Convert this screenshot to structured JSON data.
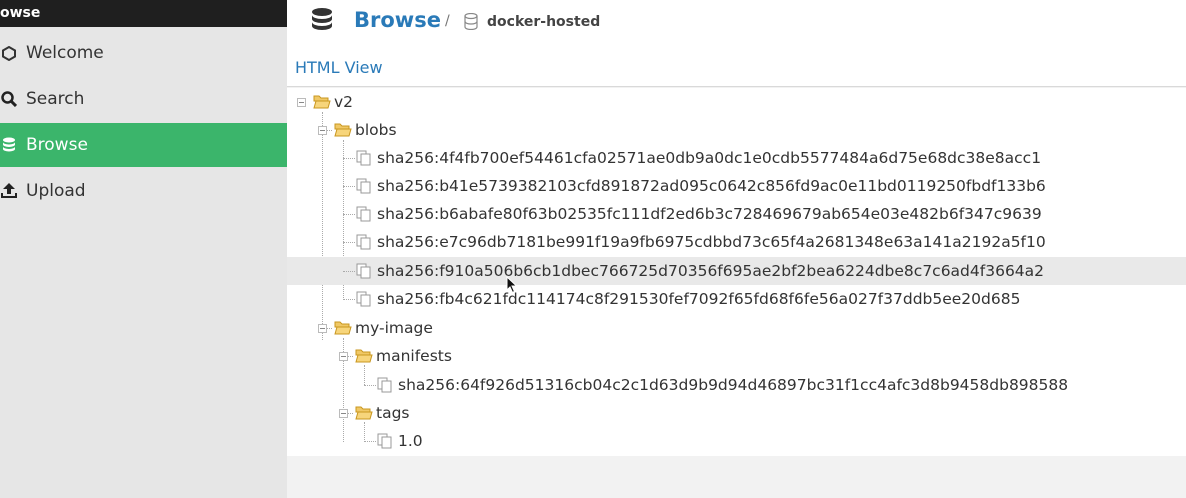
{
  "sidebar": {
    "header": "owse",
    "items": [
      {
        "label": "Welcome",
        "icon": "hexagon-icon"
      },
      {
        "label": "Search",
        "icon": "search-icon"
      },
      {
        "label": "Browse",
        "icon": "database-icon",
        "active": true
      },
      {
        "label": "Upload",
        "icon": "upload-icon"
      }
    ]
  },
  "header": {
    "title": "Browse",
    "separator": "/",
    "repository": "docker-hosted"
  },
  "view_link": "HTML View",
  "tree": {
    "root": "v2",
    "blobs": {
      "label": "blobs",
      "files": [
        "sha256:4f4fb700ef54461cfa02571ae0db9a0dc1e0cdb5577484a6d75e68dc38e8acc1",
        "sha256:b41e5739382103cfd891872ad095c0642c856fd9ac0e11bd0119250fbdf133b6",
        "sha256:b6abafe80f63b02535fc111df2ed6b3c728469679ab654e03e482b6f347c9639",
        "sha256:e7c96db7181be991f19a9fb6975cdbbd73c65f4a2681348e63a141a2192a5f10",
        "sha256:f910a506b6cb1dbec766725d70356f695ae2bf2bea6224dbe8c7c6ad4f3664a2",
        "sha256:fb4c621fdc114174c8f291530fef7092f65fd68f6fe56a027f37ddb5ee20d685"
      ]
    },
    "image": {
      "label": "my-image",
      "manifests": {
        "label": "manifests",
        "files": [
          "sha256:64f926d51316cb04c2c1d63d9b9d94d46897bc31f1cc4afc3d8b9458db898588"
        ]
      },
      "tags": {
        "label": "tags",
        "files": [
          "1.0"
        ]
      }
    }
  },
  "colors": {
    "accent": "#2a7ab8",
    "active_nav": "#3bb56b",
    "sidebar_header": "#1f1f1f"
  }
}
